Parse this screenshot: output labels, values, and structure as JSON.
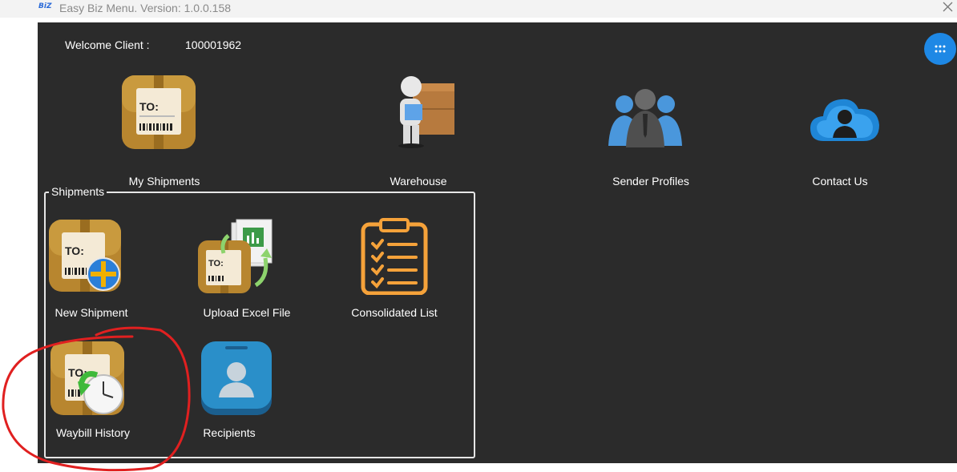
{
  "window": {
    "logo_text": "BiZ",
    "title": "Easy Biz Menu. Version: 1.0.0.158"
  },
  "header": {
    "welcome_label": "Welcome Client :",
    "client_id": "100001962"
  },
  "top_tiles": [
    {
      "label": "My Shipments",
      "icon": "package-icon"
    },
    {
      "label": "Warehouse",
      "icon": "warehouse-person-icon"
    },
    {
      "label": "Sender Profiles",
      "icon": "people-icon"
    },
    {
      "label": "Contact Us",
      "icon": "cloud-user-icon"
    }
  ],
  "shipments_group": {
    "title": "Shipments",
    "tiles": [
      {
        "label": "New Shipment",
        "icon": "new-shipment-icon"
      },
      {
        "label": "Upload Excel File",
        "icon": "excel-upload-icon"
      },
      {
        "label": "Consolidated List",
        "icon": "clipboard-checklist-icon"
      },
      {
        "label": "Waybill History",
        "icon": "history-clock-icon"
      },
      {
        "label": "Recipients",
        "icon": "contact-card-icon"
      }
    ]
  },
  "package_label_text": "TO:",
  "colors": {
    "background": "#2b2b2b",
    "accent_blue": "#1e88e5",
    "package_gold": "#b8862f",
    "checklist_orange": "#f5a23a",
    "annotation_red": "#e02020"
  }
}
